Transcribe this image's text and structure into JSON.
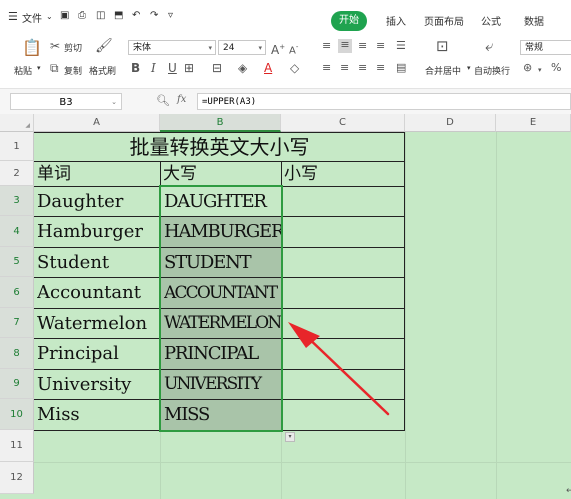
{
  "menubar": {
    "file_menu": "文件",
    "tabs": [
      "开始",
      "插入",
      "页面布局",
      "公式",
      "数据"
    ]
  },
  "ribbon": {
    "paste": "粘贴",
    "cut": "剪切",
    "copy": "复制",
    "format_painter": "格式刷",
    "font_name": "宋体",
    "font_size": "24",
    "merge_center": "合并居中",
    "wrap_text": "自动换行",
    "number_format": "常规"
  },
  "formula_bar": {
    "name_box": "B3",
    "fx": "fx",
    "formula": "=UPPER(A3)"
  },
  "sheet": {
    "columns": [
      "A",
      "B",
      "C",
      "D",
      "E"
    ],
    "rows": [
      "1",
      "2",
      "3",
      "4",
      "5",
      "6",
      "7",
      "8",
      "9",
      "10",
      "11",
      "12"
    ],
    "title": "批量转换英文大小写",
    "headers": [
      "单词",
      "大写",
      "小写"
    ],
    "data": [
      [
        "Daughter",
        "DAUGHTER"
      ],
      [
        "Hamburger",
        "HAMBURGER"
      ],
      [
        "Student",
        "STUDENT"
      ],
      [
        "Accountant",
        "ACCOUNTANT"
      ],
      [
        "Watermelon",
        "WATERMELON"
      ],
      [
        "Principal",
        "PRINCIPAL"
      ],
      [
        "University",
        "UNIVERSITY"
      ],
      [
        "Miss",
        "MISS"
      ]
    ]
  },
  "colors": {
    "accent": "#1fa34f",
    "sheet_bg": "#c6e9c6",
    "selection": "#a9c4a9",
    "arrow": "#e8252a"
  }
}
